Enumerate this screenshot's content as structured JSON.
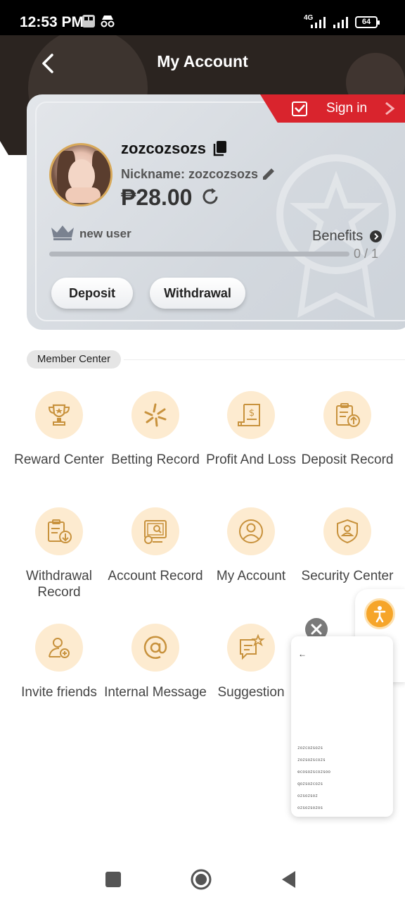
{
  "status_bar": {
    "time": "12:53 PM",
    "network": "4G",
    "battery": "64"
  },
  "header": {
    "title": "My Account"
  },
  "sign_in": {
    "label": "Sign in"
  },
  "profile": {
    "username": "zozcozsozs",
    "nickname": "Nickname: zozcozsozs",
    "balance": "₱28.00",
    "vip_label": "new user",
    "benefits_label": "Benefits",
    "progress_text": "0 / 1",
    "progress_fraction": 0.97
  },
  "actions": {
    "deposit": "Deposit",
    "withdrawal": "Withdrawal"
  },
  "member_center": {
    "title": "Member Center",
    "items": [
      {
        "label": "Reward Center",
        "icon": "trophy-icon"
      },
      {
        "label": "Betting Record",
        "icon": "sparkle-icon"
      },
      {
        "label": "Profit And Loss",
        "icon": "invoice-icon"
      },
      {
        "label": "Deposit Record",
        "icon": "clipboard-upload-icon"
      },
      {
        "label": "Withdrawal Record",
        "icon": "clipboard-download-icon"
      },
      {
        "label": "Account Record",
        "icon": "monitor-search-icon"
      },
      {
        "label": "My Account",
        "icon": "user-circle-icon"
      },
      {
        "label": "Security Center",
        "icon": "shield-user-icon"
      },
      {
        "label": "Invite friends",
        "icon": "user-add-icon"
      },
      {
        "label": "Internal Message",
        "icon": "at-icon"
      },
      {
        "label": "Suggestion",
        "icon": "message-star-icon"
      }
    ]
  },
  "pip": {
    "back": "←",
    "lines": [
      "zozcozsozs",
      "zozsozscozs",
      "ecosozscozsoo",
      "qozsozcozs",
      "ozsozsoz",
      "ozsozsozos"
    ]
  },
  "colors": {
    "accent_red": "#d9242d",
    "gold": "#d8a95a",
    "icon_bg": "#fdebd0",
    "header_dark": "#2b2420"
  }
}
